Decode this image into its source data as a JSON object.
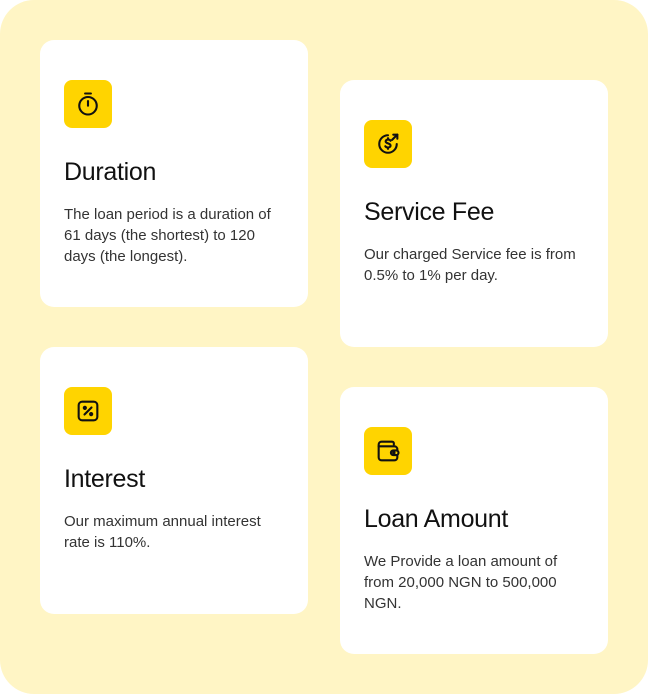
{
  "theme": {
    "background": "#FFF5C5",
    "card_background": "#FFFFFF",
    "icon_accent": "#FFD400",
    "text_primary": "#111111",
    "text_secondary": "#333333"
  },
  "cards": [
    {
      "icon": "stopwatch-icon",
      "title": "Duration",
      "description": "The loan period is a duration of 61 days (the shortest) to 120 days (the longest)."
    },
    {
      "icon": "dollar-coin-arrow-icon",
      "title": "Service Fee",
      "description": "Our charged Service fee is from 0.5% to 1% per day."
    },
    {
      "icon": "percent-icon",
      "title": "Interest",
      "description": "Our maximum annual interest rate is 110%."
    },
    {
      "icon": "wallet-icon",
      "title": "Loan Amount",
      "description": "We Provide a loan amount of from 20,000 NGN to 500,000 NGN."
    }
  ]
}
